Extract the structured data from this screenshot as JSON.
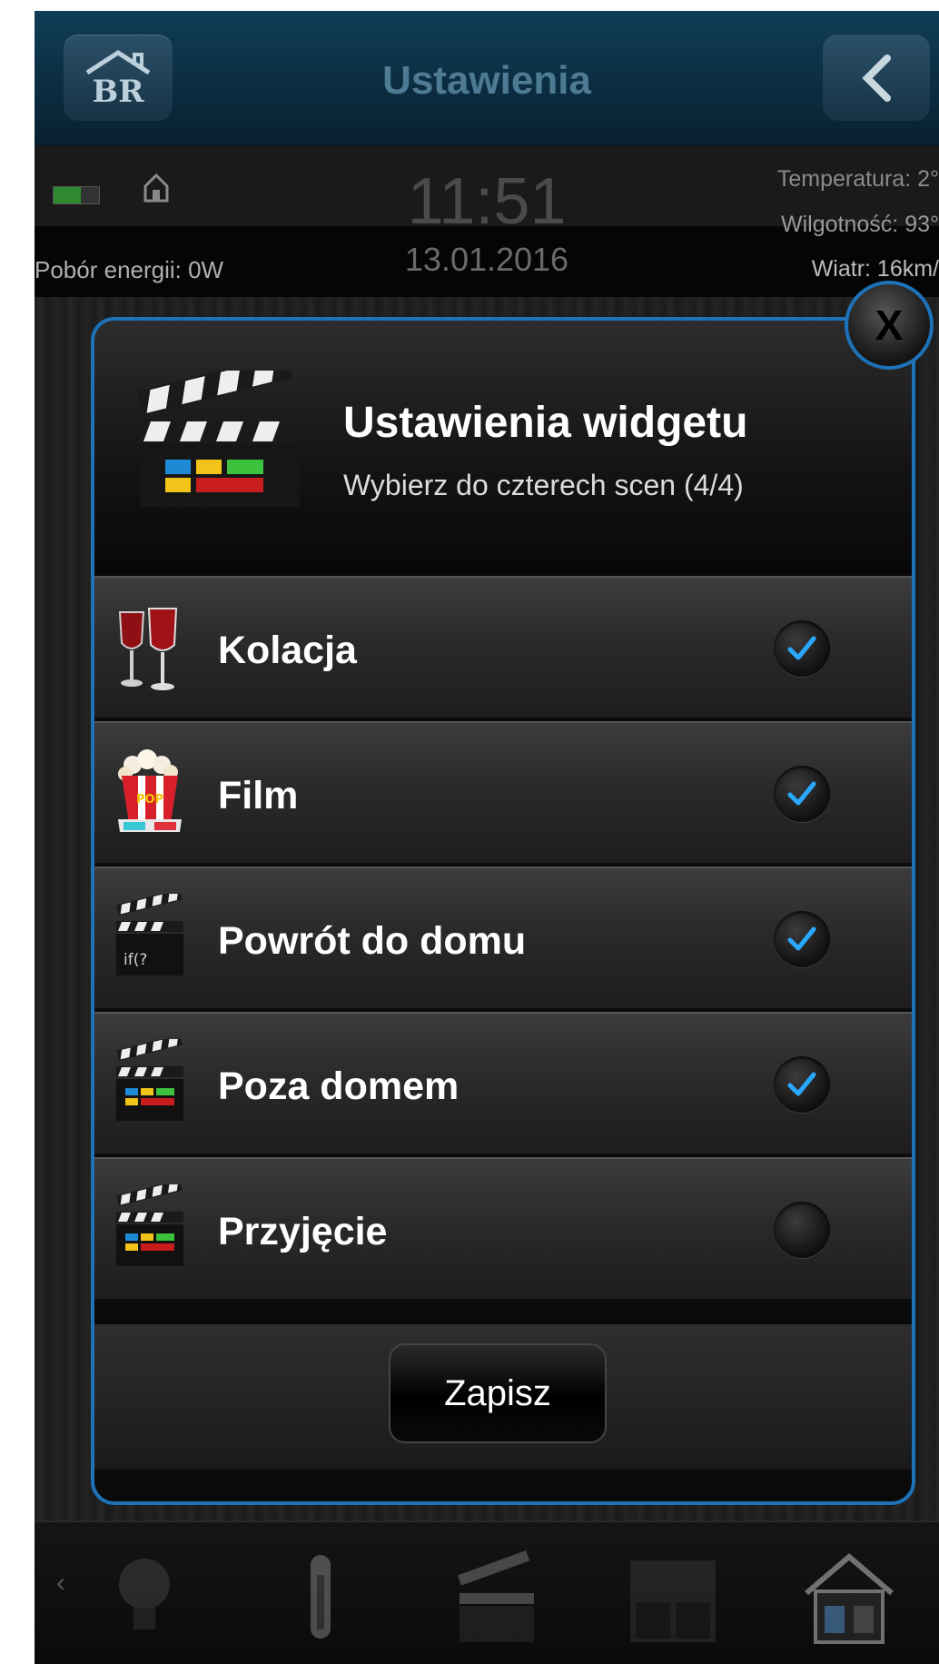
{
  "header": {
    "title": "Ustawienia",
    "logo_text": "BR"
  },
  "status": {
    "time": "11:51",
    "date": "13.01.2016",
    "energy": "Pobór energii: 0W",
    "temperature": "Temperatura: 2°",
    "humidity": "Wilgotność: 93°",
    "wind": "Wiatr: 16km/",
    "battery_level": 0.6
  },
  "modal": {
    "title": "Ustawienia widgetu",
    "subtitle": "Wybierz do czterech scen (4/4)",
    "close_label": "X",
    "save_label": "Zapisz",
    "scenes": [
      {
        "label": "Kolacja",
        "icon": "wine-glasses-icon",
        "checked": true
      },
      {
        "label": "Film",
        "icon": "popcorn-icon",
        "checked": true
      },
      {
        "label": "Powrót do domu",
        "icon": "script-clapperboard-icon",
        "icon_text": "if(?",
        "checked": true
      },
      {
        "label": "Poza domem",
        "icon": "clapperboard-icon",
        "checked": true
      },
      {
        "label": "Przyjęcie",
        "icon": "clapperboard-icon",
        "checked": false
      }
    ]
  },
  "nav": {
    "items": [
      "lightbulb-icon",
      "thermometer-icon",
      "clapperboard-icon",
      "window-blinds-icon",
      "house-icon"
    ]
  },
  "colors": {
    "accent": "#1d72b8",
    "check": "#2aa8ff",
    "header": "#0f3d56"
  }
}
